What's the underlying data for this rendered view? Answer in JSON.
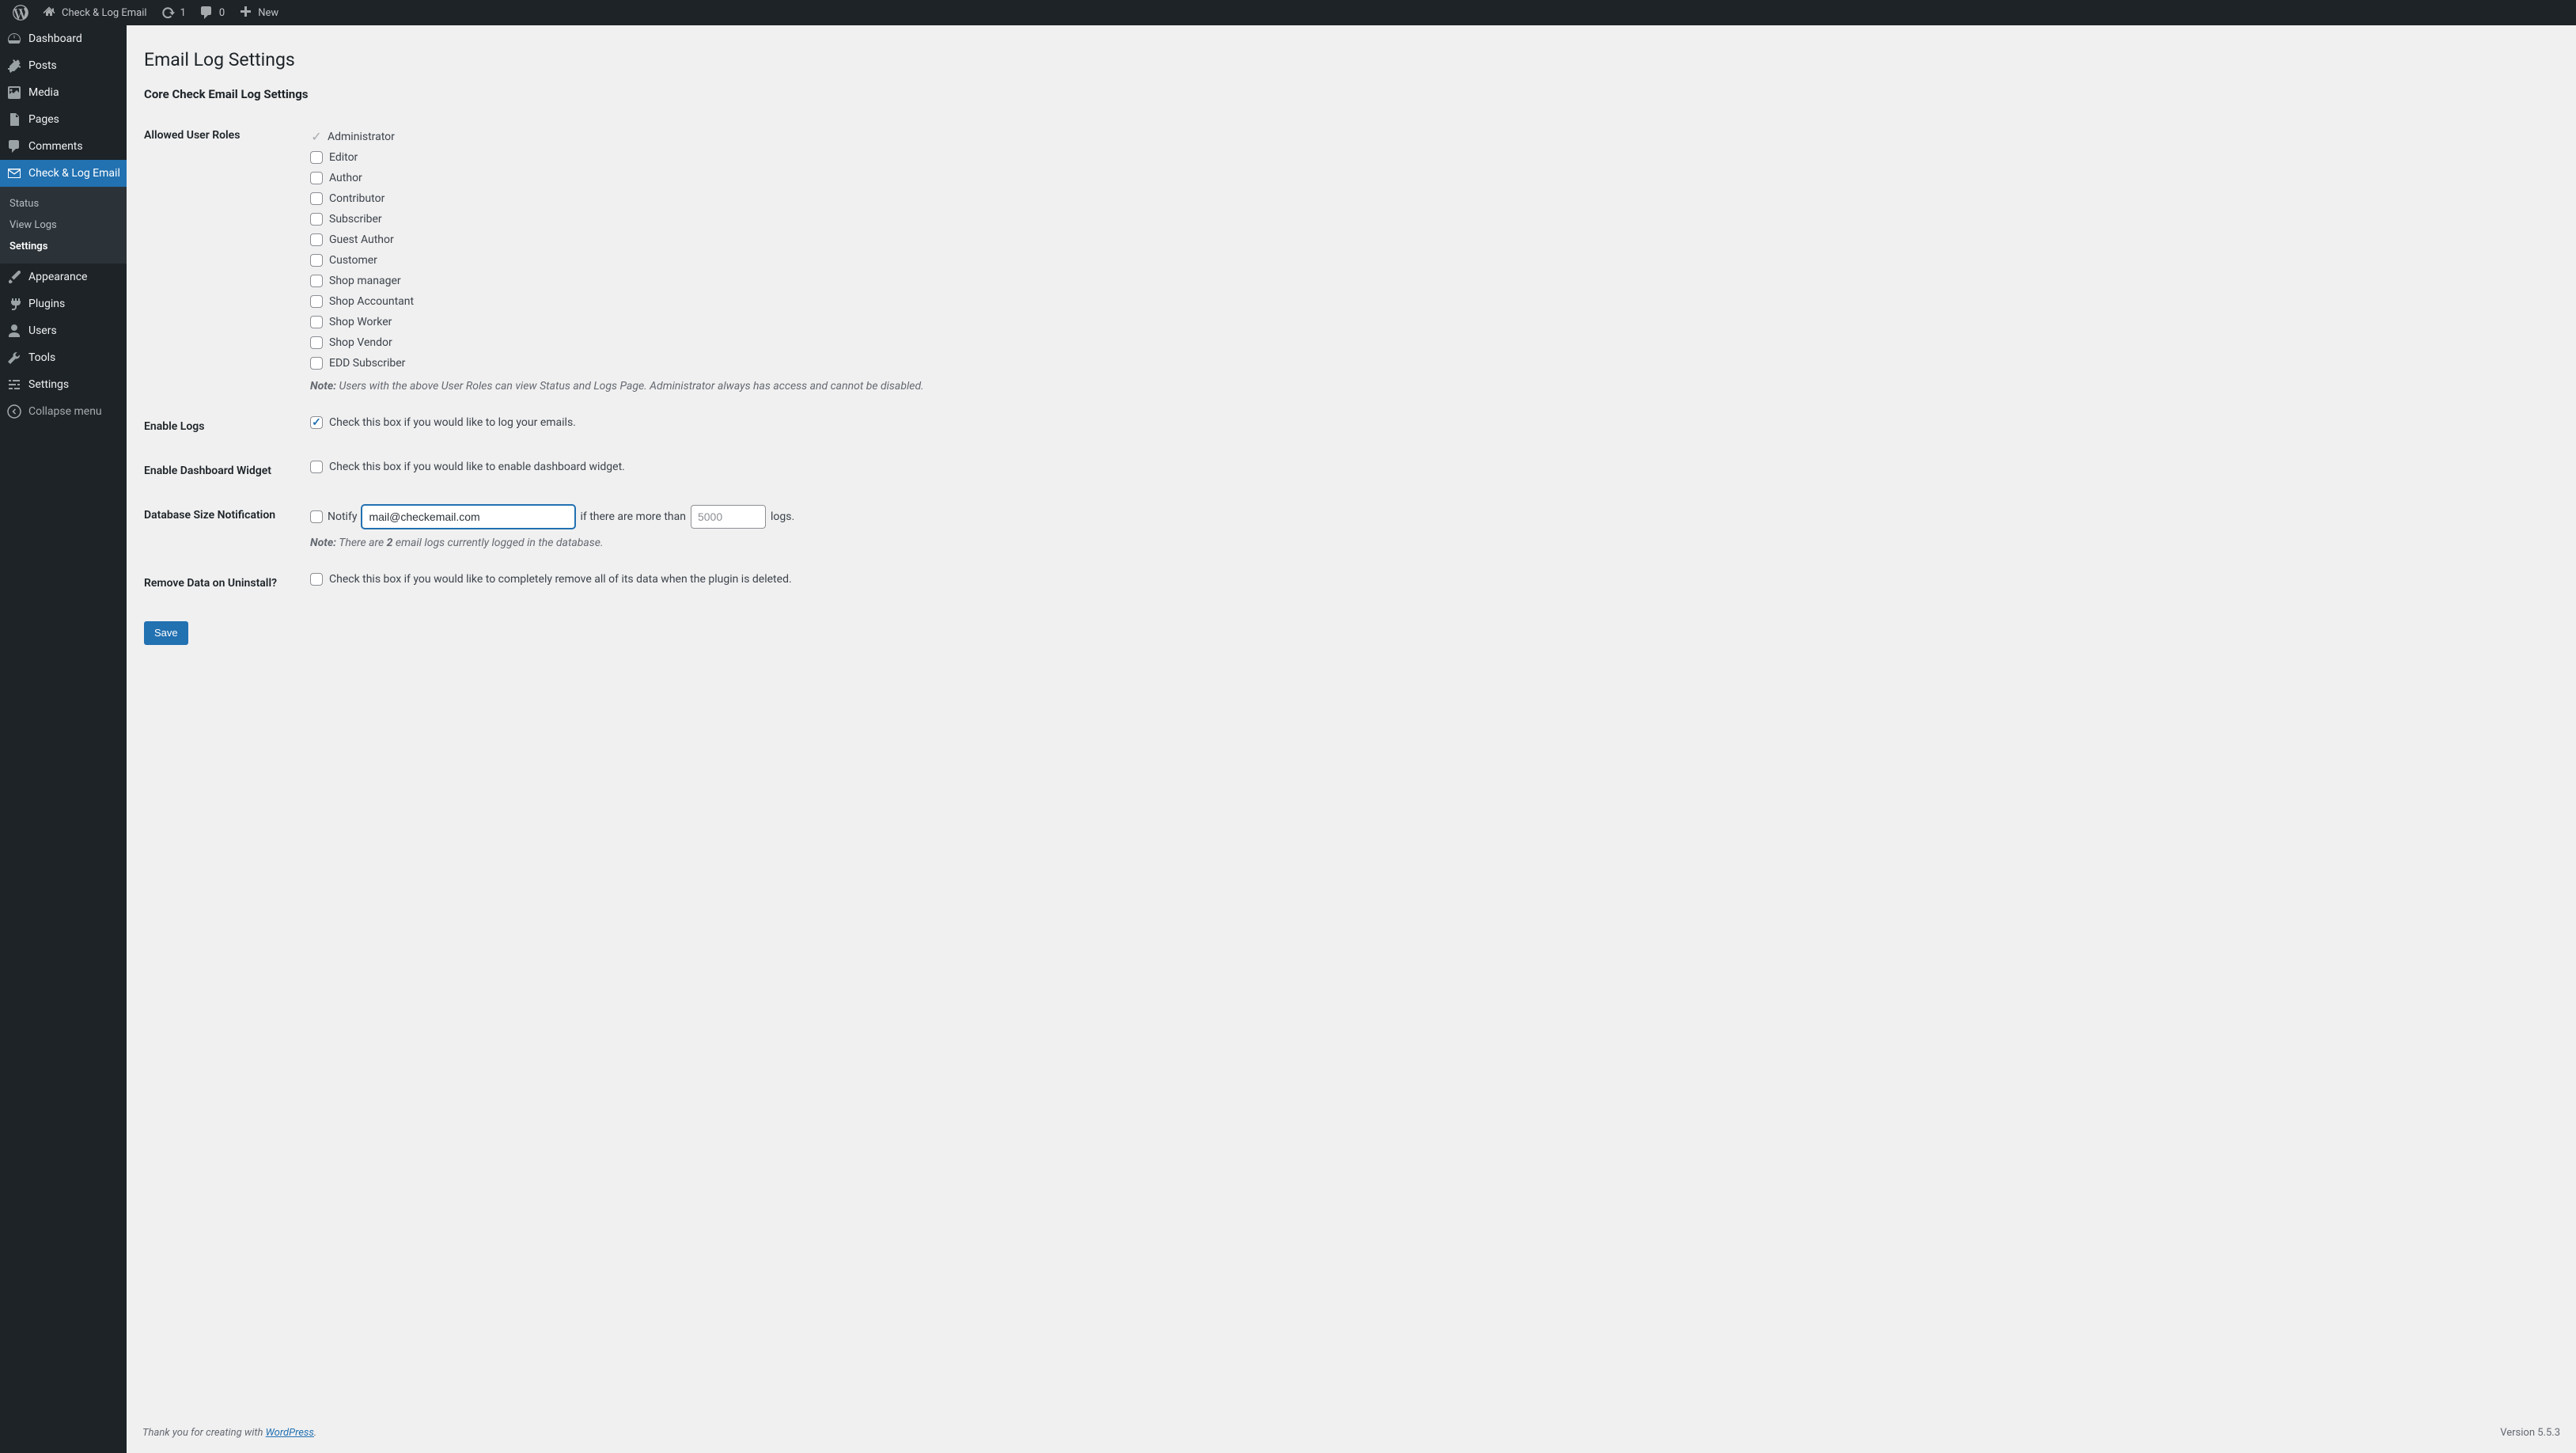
{
  "adminbar": {
    "site_name": "Check & Log Email",
    "updates_count": "1",
    "comments_count": "0",
    "new_label": "New"
  },
  "sidebar": {
    "items": [
      {
        "id": "dashboard",
        "label": "Dashboard"
      },
      {
        "id": "posts",
        "label": "Posts"
      },
      {
        "id": "media",
        "label": "Media"
      },
      {
        "id": "pages",
        "label": "Pages"
      },
      {
        "id": "comments",
        "label": "Comments"
      },
      {
        "id": "check-log-email",
        "label": "Check & Log Email"
      },
      {
        "id": "appearance",
        "label": "Appearance"
      },
      {
        "id": "plugins",
        "label": "Plugins"
      },
      {
        "id": "users",
        "label": "Users"
      },
      {
        "id": "tools",
        "label": "Tools"
      },
      {
        "id": "settings",
        "label": "Settings"
      }
    ],
    "submenu": [
      {
        "id": "status",
        "label": "Status"
      },
      {
        "id": "view-logs",
        "label": "View Logs"
      },
      {
        "id": "settings",
        "label": "Settings"
      }
    ],
    "collapse_label": "Collapse menu"
  },
  "page": {
    "title": "Email Log Settings",
    "section_title": "Core Check Email Log Settings"
  },
  "allowed_roles": {
    "label": "Allowed User Roles",
    "admin_label": "Administrator",
    "roles": [
      {
        "label": "Editor",
        "checked": false
      },
      {
        "label": "Author",
        "checked": false
      },
      {
        "label": "Contributor",
        "checked": false
      },
      {
        "label": "Subscriber",
        "checked": false
      },
      {
        "label": "Guest Author",
        "checked": false
      },
      {
        "label": "Customer",
        "checked": false
      },
      {
        "label": "Shop manager",
        "checked": false
      },
      {
        "label": "Shop Accountant",
        "checked": false
      },
      {
        "label": "Shop Worker",
        "checked": false
      },
      {
        "label": "Shop Vendor",
        "checked": false
      },
      {
        "label": "EDD Subscriber",
        "checked": false
      }
    ],
    "note_label": "Note:",
    "note": "Users with the above User Roles can view Status and Logs Page. Administrator always has access and cannot be disabled."
  },
  "enable_logs": {
    "label": "Enable Logs",
    "checked": true,
    "desc": "Check this box if you would like to log your emails."
  },
  "enable_widget": {
    "label": "Enable Dashboard Widget",
    "checked": false,
    "desc": "Check this box if you would like to enable dashboard widget."
  },
  "db_notification": {
    "label": "Database Size Notification",
    "checked": false,
    "notify_label": "Notify",
    "email_value": "mail@checkemail.com",
    "middle_text": "if there are more than",
    "threshold_placeholder": "5000",
    "threshold_value": "",
    "suffix": "logs.",
    "note_label": "Note:",
    "note_prefix": "There are ",
    "note_count": "2",
    "note_suffix": " email logs currently logged in the database."
  },
  "remove_data": {
    "label": "Remove Data on Uninstall?",
    "checked": false,
    "desc": "Check this box if you would like to completely remove all of its data when the plugin is deleted."
  },
  "save_label": "Save",
  "footer": {
    "thanks_prefix": "Thank you for creating with ",
    "wp_link": "WordPress",
    "suffix": ".",
    "version": "Version 5.5.3"
  }
}
